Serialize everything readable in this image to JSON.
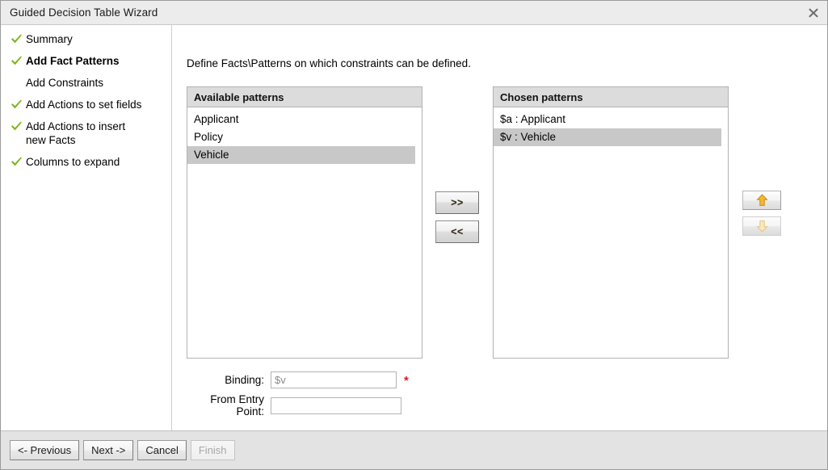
{
  "window": {
    "title": "Guided Decision Table Wizard",
    "close_icon": "close-icon"
  },
  "sidebar": {
    "steps": [
      {
        "label": "Summary",
        "done": true,
        "current": false
      },
      {
        "label": "Add Fact Patterns",
        "done": true,
        "current": true
      },
      {
        "label": "Add Constraints",
        "done": false,
        "current": false
      },
      {
        "label": "Add Actions to set fields",
        "done": true,
        "current": false
      },
      {
        "label": "Add Actions to insert new Facts",
        "done": true,
        "current": false
      },
      {
        "label": "Columns to expand",
        "done": true,
        "current": false
      }
    ]
  },
  "main": {
    "description": "Define Facts\\Patterns on which constraints can be defined.",
    "available_panel": {
      "header": "Available patterns",
      "items": [
        {
          "label": "Applicant",
          "selected": false
        },
        {
          "label": "Policy",
          "selected": false
        },
        {
          "label": "Vehicle",
          "selected": true
        }
      ]
    },
    "chosen_panel": {
      "header": "Chosen patterns",
      "items": [
        {
          "label": "$a : Applicant",
          "selected": false
        },
        {
          "label": "$v : Vehicle",
          "selected": true
        }
      ]
    },
    "transfer": {
      "add_label": ">>",
      "remove_label": "<<"
    },
    "reorder": {
      "up_icon": "arrow-up-icon",
      "down_icon": "arrow-down-icon",
      "up_enabled": true,
      "down_enabled": false
    },
    "form": {
      "binding_label": "Binding:",
      "binding_value": "$v",
      "binding_required_marker": "*",
      "entry_point_label": "From Entry Point:",
      "entry_point_value": ""
    }
  },
  "footer": {
    "buttons": [
      {
        "label": "<- Previous",
        "disabled": false
      },
      {
        "label": "Next ->",
        "disabled": false
      },
      {
        "label": "Cancel",
        "disabled": false
      },
      {
        "label": "Finish",
        "disabled": true
      }
    ]
  },
  "colors": {
    "accent_check": "#7cb518",
    "required": "#e01b1b",
    "selection": "#c8c8c8",
    "panel_header": "#dcdcdc",
    "titlebar": "#ececec",
    "footer": "#e3e3e3",
    "arrow_gold": "#f0a500"
  }
}
